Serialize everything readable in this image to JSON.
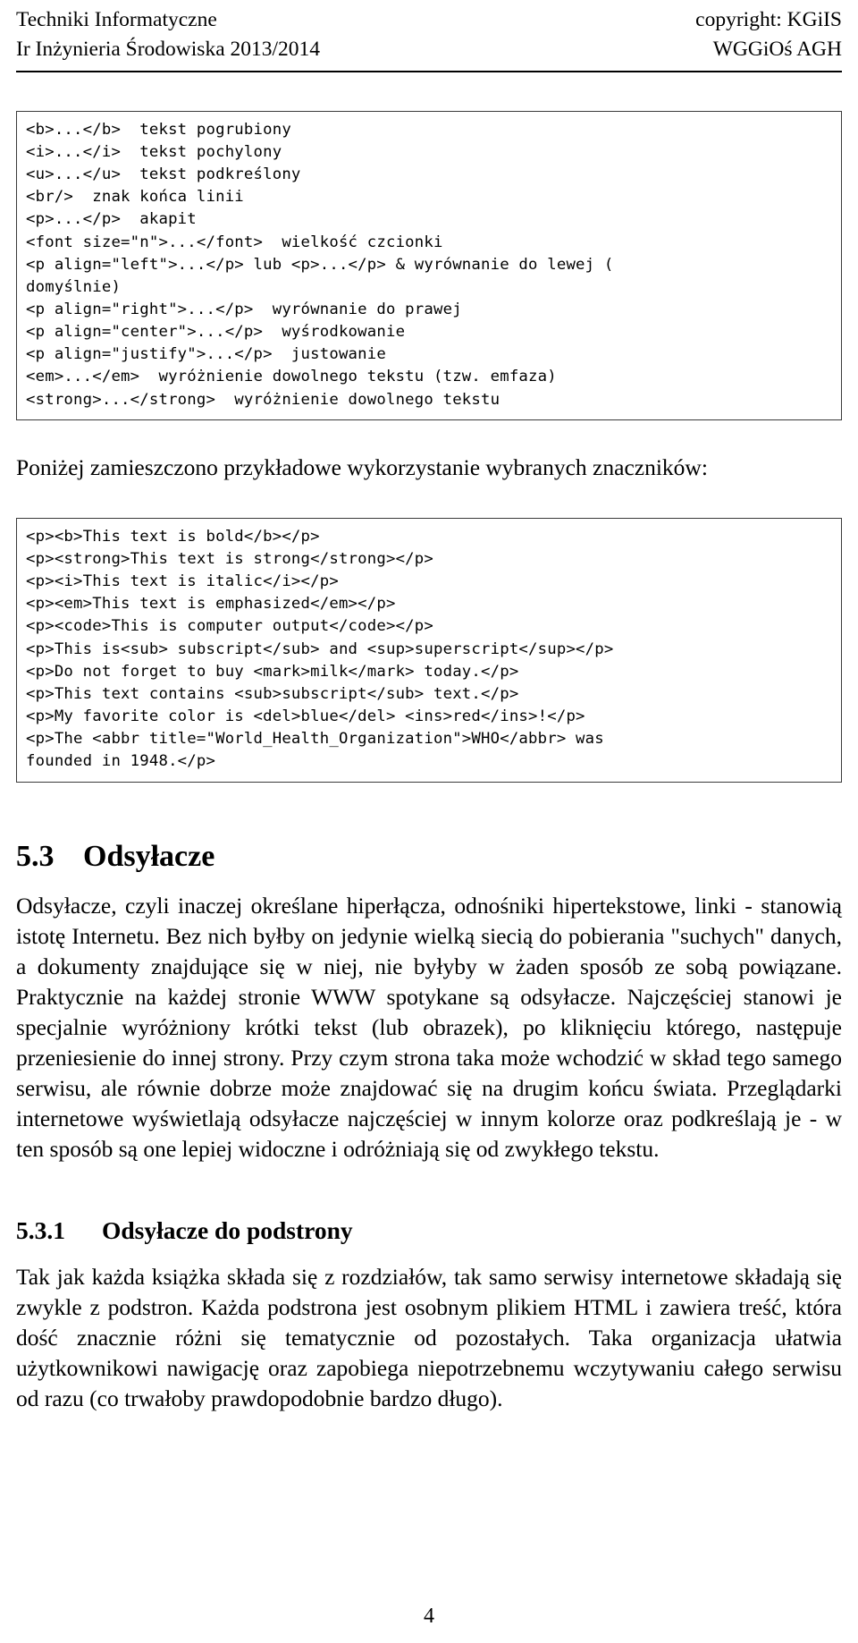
{
  "header": {
    "left_line1": "Techniki Informatyczne",
    "left_line2": "Ir Inżynieria Środowiska 2013/2014",
    "right_line1": "copyright: KGiIS",
    "right_line2": "WGGiOś AGH"
  },
  "tag_table": {
    "lines": [
      "<b>...</b>  tekst pogrubiony",
      "<i>...</i>  tekst pochylony",
      "<u>...</u>  tekst podkreślony",
      "<br/>  znak końca linii",
      "<p>...</p>  akapit",
      "<font size=\"n\">...</font>  wielkość czcionki",
      "<p align=\"left\">...</p> lub <p>...</p> & wyrównanie do lewej (",
      "domyślnie)",
      "<p align=\"right\">...</p>  wyrównanie do prawej",
      "<p align=\"center\">...</p>  wyśrodkowanie",
      "<p align=\"justify\">...</p>  justowanie",
      "<em>...</em>  wyróżnienie dowolnego tekstu (tzw. emfaza)",
      "<strong>...</strong>  wyróżnienie dowolnego tekstu"
    ]
  },
  "intro_paragraph": "Poniżej zamieszczono przykładowe wykorzystanie wybranych znaczników:",
  "example_code": {
    "lines": [
      "<p><b>This text is bold</b></p>",
      "<p><strong>This text is strong</strong></p>",
      "<p><i>This text is italic</i></p>",
      "<p><em>This text is emphasized</em></p>",
      "<p><code>This is computer output</code></p>",
      "<p>This is<sub> subscript</sub> and <sup>superscript</sup></p>",
      "<p>Do not forget to buy <mark>milk</mark> today.</p>",
      "<p>This text contains <sub>subscript</sub> text.</p>",
      "<p>My favorite color is <del>blue</del> <ins>red</ins>!</p>",
      "<p>The <abbr title=\"World_Health_Organization\">WHO</abbr> was",
      "founded in 1948.</p>"
    ]
  },
  "section": {
    "number": "5.3",
    "title": "Odsyłacze",
    "body": "Odsyłacze, czyli inaczej określane hiperłącza, odnośniki hipertekstowe, linki - stanowią istotę Internetu. Bez nich byłby on jedynie wielką siecią do pobierania \"suchych\" danych, a dokumenty znajdujące się w niej, nie byłyby w żaden sposób ze sobą powiązane. Praktycznie na każdej stronie WWW spotykane są odsyłacze. Najczęściej stanowi je specjalnie wyróżniony krótki tekst (lub obrazek), po kliknięciu którego, następuje przeniesienie do innej strony. Przy czym strona taka może wchodzić w skład tego samego serwisu, ale równie dobrze może znajdować się na drugim końcu świata. Przeglądarki internetowe wyświetlają odsyłacze najczęściej w innym kolorze oraz podkreślają je - w ten sposób są one lepiej widoczne i odróżniają się od zwykłego tekstu."
  },
  "subsection": {
    "number": "5.3.1",
    "title": "Odsyłacze do podstrony",
    "body": "Tak jak każda książka składa się z rozdziałów, tak samo serwisy internetowe składają się zwykle z podstron. Każda podstrona jest osobnym plikiem HTML i zawiera treść, która dość znacznie różni się tematycznie od pozostałych. Taka organizacja ułatwia użytkownikowi nawigację oraz zapobiega niepotrzebnemu wczytywaniu całego serwisu od razu (co trwałoby prawdopodobnie bardzo długo)."
  },
  "folio": "4"
}
